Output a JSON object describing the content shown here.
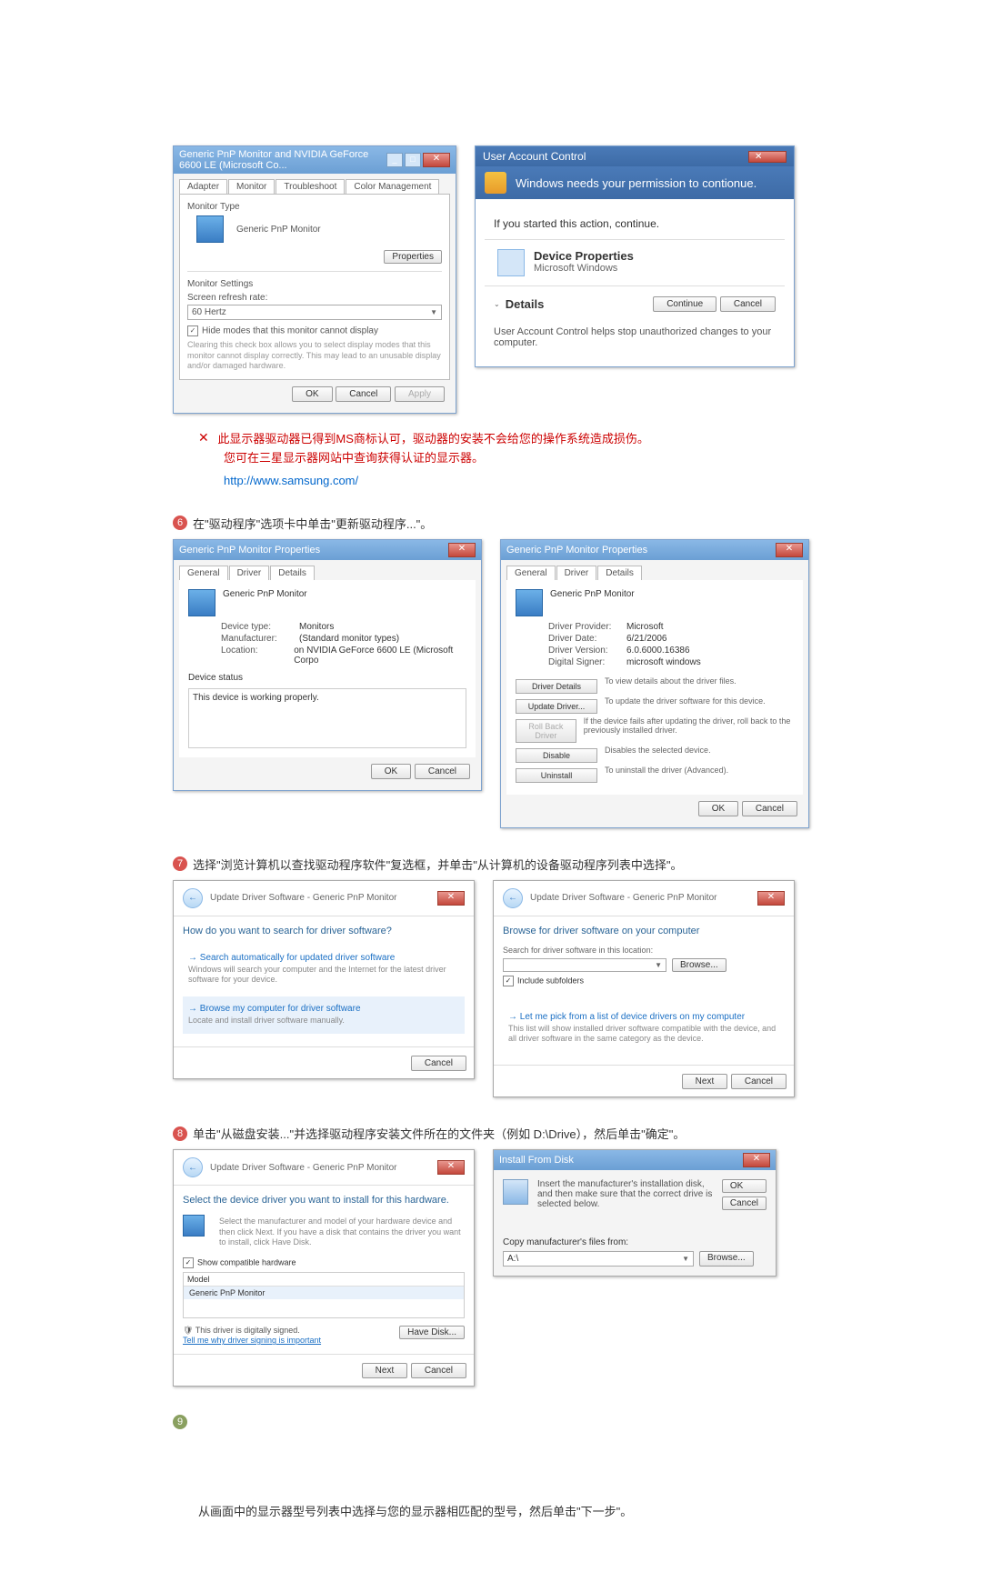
{
  "section5": {
    "dlg1": {
      "title": "Generic PnP Monitor and NVIDIA GeForce 6600 LE (Microsoft Co...",
      "tabs": [
        "Adapter",
        "Monitor",
        "Troubleshoot",
        "Color Management"
      ],
      "monitor_type_label": "Monitor Type",
      "monitor_type_value": "Generic PnP Monitor",
      "properties_btn": "Properties",
      "monitor_settings_label": "Monitor Settings",
      "refresh_label": "Screen refresh rate:",
      "refresh_value": "60 Hertz",
      "hide_modes": "Hide modes that this monitor cannot display",
      "hide_desc": "Clearing this check box allows you to select display modes that this monitor cannot display correctly. This may lead to an unusable display and/or damaged hardware.",
      "ok": "OK",
      "cancel": "Cancel",
      "apply": "Apply"
    },
    "uac": {
      "title": "User Account Control",
      "headline": "Windows needs your permission to contionue.",
      "action": "If you started this action, continue.",
      "app_name": "Device Properties",
      "app_publisher": "Microsoft Windows",
      "details": "Details",
      "continue": "Continue",
      "cancel": "Cancel",
      "footer": "User Account Control helps stop unauthorized changes to your computer."
    },
    "note1": "此显示器驱动器已得到MS商标认可，驱动器的安装不会给您的操作系统造成损伤。",
    "note2": "您可在三星显示器网站中查询获得认证的显示器。",
    "link": "http://www.samsung.com/"
  },
  "step6": {
    "label": "在\"驱动程序\"选项卡中单击\"更新驱动程序...\"。",
    "dlgL": {
      "title": "Generic PnP Monitor Properties",
      "tabs": [
        "General",
        "Driver",
        "Details"
      ],
      "name": "Generic PnP Monitor",
      "rows": [
        {
          "k": "Device type:",
          "v": "Monitors"
        },
        {
          "k": "Manufacturer:",
          "v": "(Standard monitor types)"
        },
        {
          "k": "Location:",
          "v": "on NVIDIA GeForce 6600 LE (Microsoft Corpo"
        }
      ],
      "status_label": "Device status",
      "status": "This device is working properly.",
      "ok": "OK",
      "cancel": "Cancel"
    },
    "dlgR": {
      "title": "Generic PnP Monitor Properties",
      "tabs": [
        "General",
        "Driver",
        "Details"
      ],
      "name": "Generic PnP Monitor",
      "rows": [
        {
          "k": "Driver Provider:",
          "v": "Microsoft"
        },
        {
          "k": "Driver Date:",
          "v": "6/21/2006"
        },
        {
          "k": "Driver Version:",
          "v": "6.0.6000.16386"
        },
        {
          "k": "Digital Signer:",
          "v": "microsoft windows"
        }
      ],
      "buttons": [
        {
          "b": "Driver Details",
          "d": "To view details about the driver files."
        },
        {
          "b": "Update Driver...",
          "d": "To update the driver software for this device."
        },
        {
          "b": "Roll Back Driver",
          "d": "If the device fails after updating the driver, roll back to the previously installed driver."
        },
        {
          "b": "Disable",
          "d": "Disables the selected device."
        },
        {
          "b": "Uninstall",
          "d": "To uninstall the driver (Advanced)."
        }
      ],
      "ok": "OK",
      "cancel": "Cancel"
    }
  },
  "step7": {
    "label": "选择\"浏览计算机以查找驱动程序软件\"复选框，并单击\"从计算机的设备驱动程序列表中选择\"。",
    "wizL": {
      "crumb": "Update Driver Software - Generic PnP Monitor",
      "q": "How do you want to search for driver software?",
      "opt1_t": "Search automatically for updated driver software",
      "opt1_d": "Windows will search your computer and the Internet for the latest driver software for your device.",
      "opt2_t": "Browse my computer for driver software",
      "opt2_d": "Locate and install driver software manually.",
      "cancel": "Cancel"
    },
    "wizR": {
      "crumb": "Update Driver Software - Generic PnP Monitor",
      "q": "Browse for driver software on your computer",
      "search_label": "Search for driver software in this location:",
      "path": "",
      "browse": "Browse...",
      "include": "Include subfolders",
      "opt_t": "Let me pick from a list of device drivers on my computer",
      "opt_d": "This list will show installed driver software compatible with the device, and all driver software in the same category as the device.",
      "next": "Next",
      "cancel": "Cancel"
    }
  },
  "step8": {
    "label": "单击\"从磁盘安装...\"并选择驱动程序安装文件所在的文件夹（例如 D:\\Drive），然后单击\"确定\"。",
    "wizL": {
      "crumb": "Update Driver Software - Generic PnP Monitor",
      "q": "Select the device driver you want to install for this hardware.",
      "desc": "Select the manufacturer and model of your hardware device and then click Next. If you have a disk that contains the driver you want to install, click Have Disk.",
      "compat": "Show compatible hardware",
      "model_h": "Model",
      "model_v": "Generic PnP Monitor",
      "signed": "This driver is digitally signed.",
      "tell": "Tell me why driver signing is important",
      "have_disk": "Have Disk...",
      "next": "Next",
      "cancel": "Cancel"
    },
    "install": {
      "title": "Install From Disk",
      "text": "Insert the manufacturer's installation disk, and then make sure that the correct drive is selected below.",
      "ok": "OK",
      "cancel": "Cancel",
      "copy": "Copy manufacturer's files from:",
      "path": "A:\\",
      "browse": "Browse..."
    }
  },
  "step_final": "从画面中的显示器型号列表中选择与您的显示器相匹配的型号，然后单击\"下一步\"。"
}
